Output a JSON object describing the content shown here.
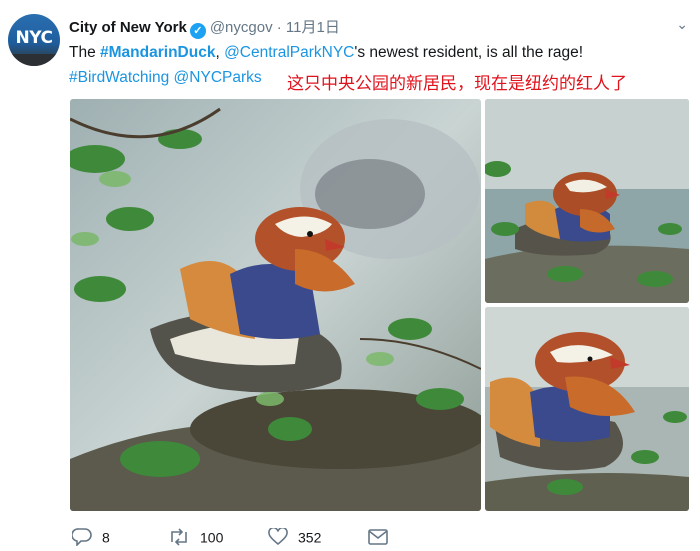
{
  "tweet": {
    "display_name": "City of New York",
    "handle": "@nycgov",
    "separator": "·",
    "date": "11月1日",
    "avatar_text": "NYC",
    "verified_glyph": "✓",
    "menu_glyph": "⌄",
    "text": {
      "prefix": "The ",
      "hashtag_main": "#MandarinDuck",
      "comma": ", ",
      "mention": "@CentralParkNYC",
      "rest": "'s newest resident, is all the rage!",
      "hashtag_2": "#BirdWatching",
      "space": " ",
      "mention_2": "@NYCParks"
    },
    "overlay_caption": "这只中央公园的新居民，现在是纽约的红人了"
  },
  "actions": {
    "reply_count": "8",
    "retweet_count": "100",
    "like_count": "352"
  },
  "icons": {
    "reply": "reply-icon",
    "retweet": "retweet-icon",
    "like": "heart-icon",
    "message": "envelope-icon",
    "verified": "verified-badge-icon",
    "menu": "chevron-down-icon"
  },
  "colors": {
    "link": "#1b95e0",
    "verified": "#1da1f2",
    "overlay_text": "#e0121b",
    "meta": "#657786"
  }
}
